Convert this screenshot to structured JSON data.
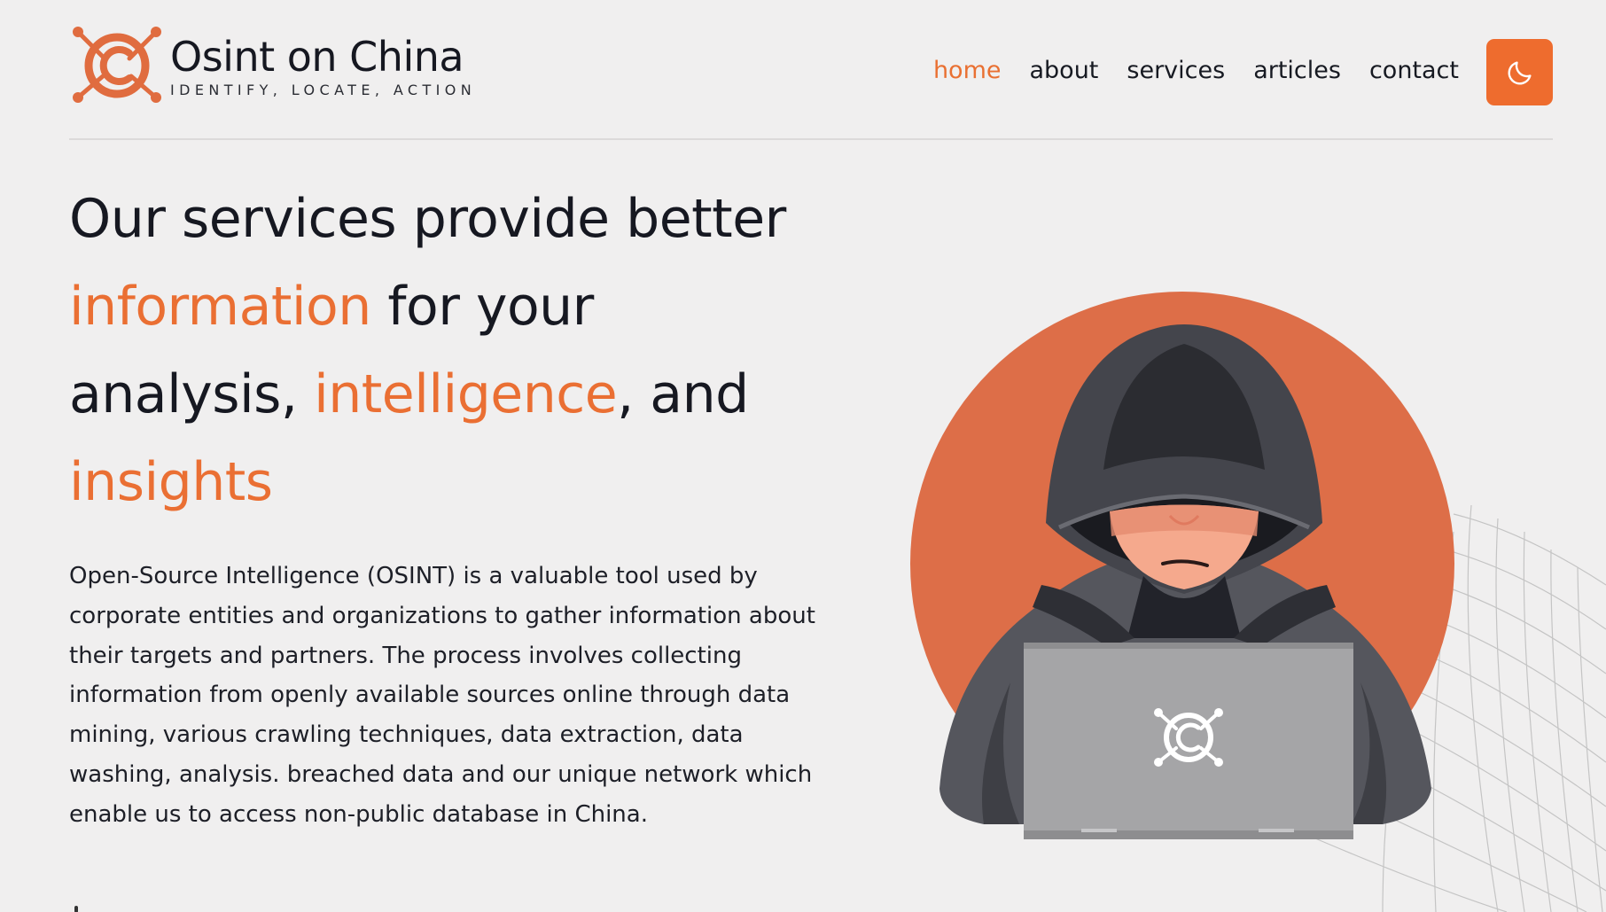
{
  "brand": {
    "name": "Osint on China",
    "tagline": "IDENTIFY, LOCATE, ACTION",
    "logo_icon": "crosshair-c-logo",
    "color": "#e06c3f"
  },
  "nav": {
    "items": [
      {
        "label": "home",
        "active": true
      },
      {
        "label": "about",
        "active": false
      },
      {
        "label": "services",
        "active": false
      },
      {
        "label": "articles",
        "active": false
      },
      {
        "label": "contact",
        "active": false
      }
    ],
    "active_color": "#e97032",
    "theme_toggle_icon": "moon-icon",
    "theme_toggle_color": "#ee6c2e"
  },
  "hero": {
    "heading": {
      "l1": "Our services provide better",
      "l2_highlight": "information",
      "l2_rest": " for your",
      "l3_start": "analysis, ",
      "l3_highlight": "intelligence",
      "l3_end": ", and",
      "l4_highlight": "insights"
    },
    "highlight_color": "#ea6f33",
    "description": "Open-Source Intelligence (OSINT) is a valuable tool used by corporate entities and organizations to gather information about their targets and partners. The process involves collecting information from openly available sources online through data mining, various crawling techniques, data extraction, data washing, analysis. breached data and our unique network which enable us to access non-public database in China.",
    "illustration": {
      "subject": "hooded-hacker-with-laptop",
      "circle_color": "#dd6e48",
      "laptop_icon": "crosshair-c-logo"
    }
  }
}
